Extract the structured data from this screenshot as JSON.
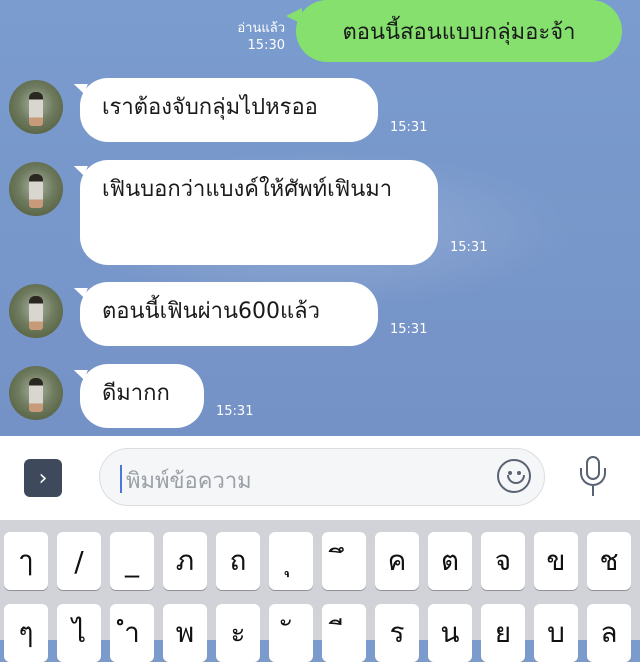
{
  "chat": {
    "outgoing": {
      "read_status": "อ่านแล้ว",
      "time": "15:30",
      "text": "ตอนนี้สอนแบบกลุ่มอะจ้า"
    },
    "incoming": [
      {
        "text": "เราต้องจับกลุ่มไปหรออ",
        "time": "15:31"
      },
      {
        "text": "เฟินบอกว่าแบงค์ให้ศัพท์เฟินมา",
        "time": "15:31"
      },
      {
        "text": "ตอนนี้เฟินผ่าน600แล้ว",
        "time": "15:31"
      },
      {
        "text": "ดีมากก",
        "time": "15:31"
      }
    ]
  },
  "input": {
    "placeholder": "พิมพ์ข้อความ",
    "expand_icon": "chevron-right-icon",
    "emoji_icon": "smiley-icon",
    "mic_icon": "microphone-icon"
  },
  "keyboard": {
    "row1": [
      "ๅ",
      "/",
      "_",
      "ภ",
      "ถ",
      "ุ",
      "ึ",
      "ค",
      "ต",
      "จ",
      "ข",
      "ช"
    ],
    "row2": [
      "ๆ",
      "ไ",
      "ำ",
      "พ",
      "ะ",
      "ั",
      "ี",
      "ร",
      "น",
      "ย",
      "บ",
      "ล"
    ]
  },
  "colors": {
    "chat_background": "#7c9bcd",
    "outgoing_bubble": "#85e06e",
    "incoming_bubble": "#ffffff",
    "keyboard_background": "#d1d3d9"
  }
}
